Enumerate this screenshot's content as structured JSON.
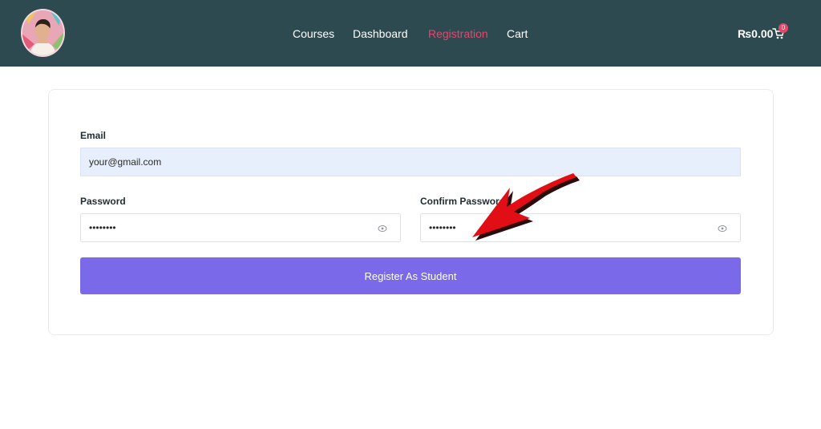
{
  "header": {
    "nav": [
      {
        "label": "Courses",
        "active": false
      },
      {
        "label": "Dashboard",
        "active": false
      },
      {
        "label": "Registration",
        "active": true
      },
      {
        "label": "Cart",
        "active": false
      }
    ],
    "cart_total": "₨0.00",
    "cart_count": "0",
    "cart_icon": "shopping-cart-icon"
  },
  "form": {
    "email_label": "Email",
    "email_value": "your@gmail.com",
    "password_label": "Password",
    "password_value": "••••••••",
    "confirm_label": "Confirm Password",
    "confirm_value": "••••••••",
    "eye_icon": "eye-icon",
    "submit_label": "Register As Student"
  },
  "colors": {
    "header_bg": "#2c4a50",
    "active_nav": "#e8456b",
    "button": "#7a69e8",
    "email_bg": "#e8effc",
    "annotation_arrow": "#e10f15"
  },
  "annotation": {
    "type": "red-arrow",
    "points_to": "confirm-password-field"
  }
}
